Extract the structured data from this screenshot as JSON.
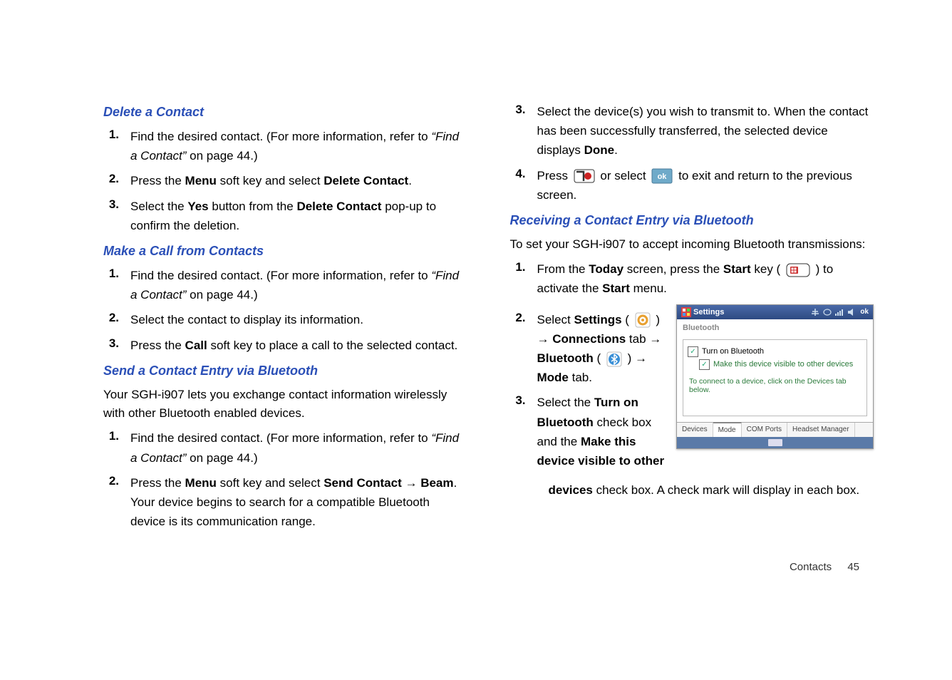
{
  "left": {
    "h1": "Delete a Contact",
    "steps1": [
      {
        "n": "1.",
        "html": "Find the desired contact. (For more information, refer to <span class='italic'>&ldquo;Find a Contact&rdquo;</span>  on page 44.)"
      },
      {
        "n": "2.",
        "html": "Press the <b>Menu</b> soft key and select <b>Delete Contact</b>."
      },
      {
        "n": "3.",
        "html": "Select the <b>Yes</b> button from the <b>Delete Contact</b> pop-up to confirm the deletion."
      }
    ],
    "h2": "Make a Call from Contacts",
    "steps2": [
      {
        "n": "1.",
        "html": "Find the desired contact. (For more information, refer to <span class='italic'>&ldquo;Find a Contact&rdquo;</span>  on page 44.)"
      },
      {
        "n": "2.",
        "html": "Select the contact to display its information."
      },
      {
        "n": "3.",
        "html": "Press the <b>Call</b> soft key to place a call to the selected contact."
      }
    ],
    "h3": "Send a Contact Entry via Bluetooth",
    "p3": "Your SGH-i907 lets you exchange contact information wirelessly with other Bluetooth enabled devices.",
    "steps3": [
      {
        "n": "1.",
        "html": "Find the desired contact. (For more information, refer to <span class='italic'>&ldquo;Find a Contact&rdquo;</span>  on page 44.)"
      },
      {
        "n": "2.",
        "html": "Press the <b>Menu</b> soft key and select <b>Send Contact &rarr; Beam</b>. Your device begins to search for a compatible Bluetooth device is its communication range."
      }
    ]
  },
  "right": {
    "stepsTop": [
      {
        "n": "3.",
        "html": "Select the device(s) you wish to transmit to. When the contact has been successfully transferred, the selected device displays <b>Done</b>."
      },
      {
        "n": "4.",
        "html": "Press  <svg class='inline-icon' data-name='end-key-icon' data-interactable='false' width='30' height='20'><rect x='1' y='1' width='28' height='18' rx='3' fill='#fff' stroke='#333'/><circle cx='20' cy='10' r='5' fill='#c22'/><path d='M4 4 L14 4 L14 17' fill='none' stroke='#333' stroke-width='2.5'/></svg>  or select  <svg class='inline-icon' data-name='ok-button-icon' data-interactable='false' width='30' height='22'><rect x='1' y='1' width='28' height='20' rx='2' fill='#6faac9' stroke='#4a7a99'/><text x='15' y='15' font-size='11' font-weight='bold' fill='#fff' text-anchor='middle'>ok</text></svg>  to exit and return to the previous screen."
      }
    ],
    "h1": "Receiving a Contact Entry via Bluetooth",
    "p1": "To set your SGH-i907 to accept incoming Bluetooth transmissions:",
    "stepsBottom": [
      {
        "n": "1.",
        "html": "From the <b>Today</b> screen, press the <b>Start</b> key ( <svg class='inline-icon' data-name='start-key-icon' data-interactable='false' width='34' height='20'><rect x='1' y='1' width='32' height='18' rx='5' fill='#fff' stroke='#333'/><rect x='6' y='5' width='11' height='10' rx='1' fill='#c33'/><rect x='7.5' y='6.5' width='3' height='3' fill='#fff'/><rect x='11.5' y='6.5' width='3' height='3' fill='#fff'/><rect x='7.5' y='10.5' width='3' height='3' fill='#fff'/><rect x='11.5' y='10.5' width='3' height='3' fill='#fff'/></svg> ) to activate the <b>Start</b> menu."
      },
      {
        "n": "2.",
        "html": "Select <b>Settings</b> ( <svg class='inline-icon' data-name='settings-icon' data-interactable='false' width='22' height='22'><rect x='1' y='1' width='20' height='20' rx='3' fill='#fff' stroke='#bbb'/><circle cx='11' cy='11' r='6' fill='none' stroke='#e8a030' stroke-width='3'/><circle cx='11' cy='11' r='2' fill='#e8a030'/></svg> ) &rarr; <b>Connections</b> tab &rarr; <b>Bluetooth</b> ( <svg class='inline-icon' data-name='bluetooth-icon' data-interactable='false' width='22' height='22'><rect x='1' y='1' width='20' height='20' rx='3' fill='#fff' stroke='#bbb'/><circle cx='11' cy='11' r='8' fill='#3a8fd6'/><path d='M11 4 L11 18 L15 14 L7 8 M11 4 L15 8 L7 14' fill='none' stroke='#fff' stroke-width='1.5'/></svg> ) &rarr; <b>Mode</b> tab."
      },
      {
        "n": "3.",
        "html": "Select the <b>Turn on Bluetooth</b> check box and the <b>Make this device visible to other devices</b> check box. A check mark will display in each box."
      }
    ]
  },
  "screenshot": {
    "title": "Settings",
    "ok": "ok",
    "section": "Bluetooth",
    "cb1": "Turn on Bluetooth",
    "cb2": "Make this device visible to other devices",
    "hint": "To connect to a device, click on the Devices tab below.",
    "tabs": [
      "Devices",
      "Mode",
      "COM Ports",
      "Headset Manager"
    ]
  },
  "footer": {
    "label": "Contacts",
    "page": "45"
  }
}
